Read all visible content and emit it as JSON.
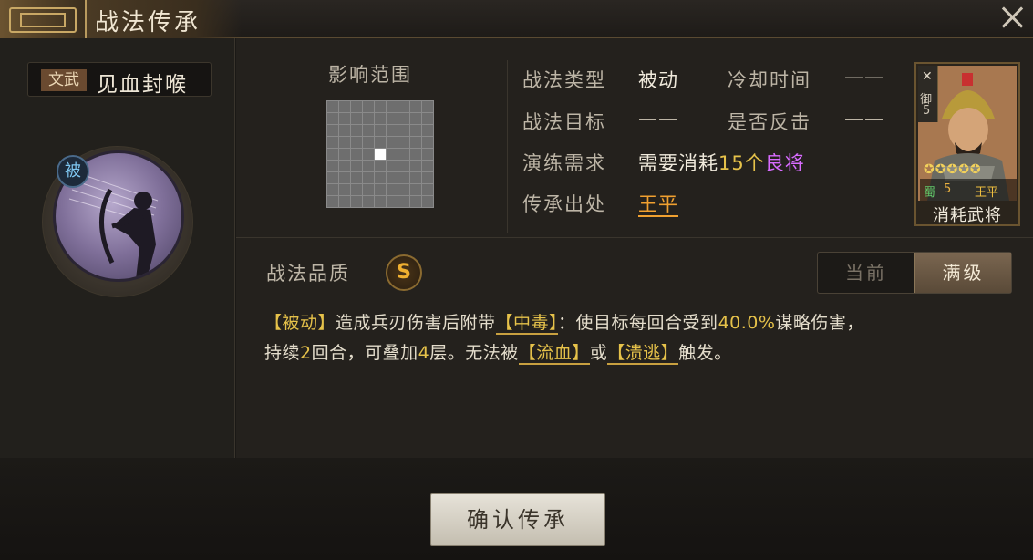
{
  "header": {
    "title": "战法传承"
  },
  "skill": {
    "tag": "文武",
    "name": "见血封喉",
    "passive_badge": "被"
  },
  "range": {
    "label": "影响范围",
    "grid_size": 9,
    "center_index": 40
  },
  "info": {
    "type_label": "战法类型",
    "type_value": "被动",
    "cooldown_label": "冷却时间",
    "cooldown_value": "——",
    "target_label": "战法目标",
    "target_value": "——",
    "counter_label": "是否反击",
    "counter_value": "——",
    "training_label": "演练需求",
    "training_prefix": "需要消耗",
    "training_count": "15个",
    "training_item": "良将",
    "origin_label": "传承出处",
    "origin_value": "王平"
  },
  "hero": {
    "side_icon": "✕",
    "side_glyph": "御",
    "side_num": "5",
    "stars": "✪✪✪✪✪",
    "faction": "蜀",
    "level": "5",
    "name": "王平",
    "consume_label": "消耗武将"
  },
  "quality": {
    "label": "战法品质",
    "grade": "S"
  },
  "toggle": {
    "current": "当前",
    "max": "满级"
  },
  "description": {
    "p1": "【被动】",
    "p2": "造成兵刃伤害后附带",
    "k1": "【中毒】",
    "p3": "：使目标每回合受到",
    "num1": "40.0%",
    "p4": "谋略伤害，",
    "p5": "持续",
    "num2": "2",
    "p6": "回合，可叠加",
    "num3": "4",
    "p7": "层。无法被",
    "k2": "【流血】",
    "p8": "或",
    "k3": "【溃逃】",
    "p9": "触发。"
  },
  "footer": {
    "confirm_label": "确认传承"
  },
  "colors": {
    "gold": "#e6c24a",
    "purple": "#d86bff",
    "orange": "#f0a030"
  }
}
